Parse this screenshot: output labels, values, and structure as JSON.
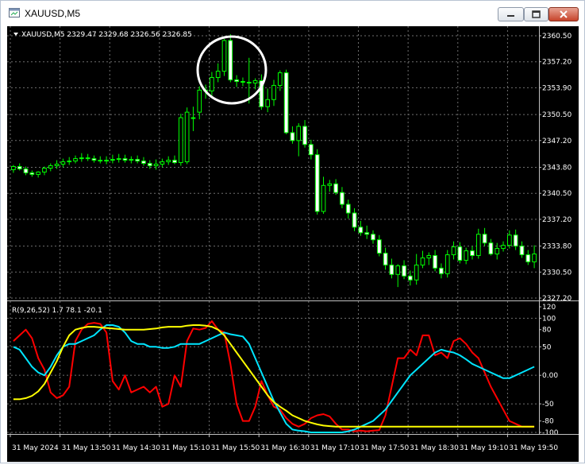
{
  "window": {
    "title": "XAUUSD,M5"
  },
  "main_chart": {
    "header": "XAUUSD,M5  2329.47 2329.68 2326.56 2326.85",
    "price_ticks": [
      "2360.50",
      "2357.20",
      "2353.90",
      "2350.50",
      "2347.20",
      "2343.80",
      "2340.50",
      "2337.20",
      "2333.80",
      "2330.50",
      "2327.20"
    ]
  },
  "indicator": {
    "header": "R(9,26,52) 1.7 78.1 -20.1",
    "ticks": [
      "120",
      "100",
      "80",
      "50",
      "0.00",
      "-50",
      "-80",
      "-100"
    ]
  },
  "time_axis": [
    "31 May 2024",
    "31 May 13:50",
    "31 May 14:30",
    "31 May 15:10",
    "31 May 15:50",
    "31 May 16:30",
    "31 May 17:10",
    "31 May 17:50",
    "31 May 18:30",
    "31 May 19:10",
    "31 May 19:50"
  ],
  "colors": {
    "background": "#000000",
    "grid": "#6f6f6f",
    "bull": "#00ff00",
    "bear": "#ffffff",
    "fast": "#ff0000",
    "mid": "#00e5ff",
    "slow": "#ffff00"
  },
  "chart_data": [
    {
      "type": "candlestick",
      "title": "XAUUSD,M5",
      "x": [
        "12:55",
        "13:00",
        "13:05",
        "13:10",
        "13:15",
        "13:20",
        "13:25",
        "13:30",
        "13:35",
        "13:40",
        "13:45",
        "13:50",
        "13:55",
        "14:00",
        "14:05",
        "14:10",
        "14:15",
        "14:20",
        "14:25",
        "14:30",
        "14:35",
        "14:40",
        "14:45",
        "14:50",
        "14:55",
        "15:00",
        "15:05",
        "15:10",
        "15:15",
        "15:20",
        "15:25",
        "15:30",
        "15:35",
        "15:40",
        "15:45",
        "15:50",
        "15:55",
        "16:00",
        "16:05",
        "16:10",
        "16:15",
        "16:20",
        "16:25",
        "16:30",
        "16:35",
        "16:40",
        "16:45",
        "16:50",
        "16:55",
        "17:00",
        "17:05",
        "17:10",
        "17:15",
        "17:20",
        "17:25",
        "17:30",
        "17:35",
        "17:40",
        "17:45",
        "17:50",
        "17:55",
        "18:00",
        "18:05",
        "18:10",
        "18:15",
        "18:20",
        "18:25",
        "18:30",
        "18:35",
        "18:40",
        "18:45",
        "18:50",
        "18:55",
        "19:00",
        "19:05",
        "19:10",
        "19:15",
        "19:20",
        "19:25",
        "19:30",
        "19:35",
        "19:40",
        "19:45",
        "19:50",
        "19:55"
      ],
      "open": [
        2343.5,
        2343.9,
        2343.6,
        2343.1,
        2342.9,
        2343.2,
        2343.7,
        2344.0,
        2344.2,
        2344.5,
        2344.6,
        2344.9,
        2345.0,
        2344.9,
        2344.7,
        2344.6,
        2344.7,
        2344.8,
        2344.9,
        2344.7,
        2344.8,
        2344.6,
        2344.3,
        2344.0,
        2344.2,
        2344.5,
        2344.7,
        2344.4,
        2344.5,
        2350.1,
        2350.8,
        2353.6,
        2353.5,
        2355.2,
        2356.0,
        2359.9,
        2354.9,
        2354.7,
        2354.6,
        2354.5,
        2354.8,
        2351.5,
        2352.4,
        2354.2,
        2355.8,
        2348.2,
        2347.2,
        2349.0,
        2346.7,
        2345.4,
        2338.2,
        2341.5,
        2341.7,
        2340.6,
        2339.1,
        2338.0,
        2336.2,
        2335.5,
        2335.3,
        2334.6,
        2332.9,
        2331.4,
        2330.2,
        2331.3,
        2330.0,
        2329.5,
        2331.4,
        2332.3,
        2332.6,
        2331.0,
        2330.3,
        2332.7,
        2333.7,
        2332.0,
        2333.2,
        2332.6,
        2335.3,
        2334.2,
        2332.8,
        2333.5,
        2333.9,
        2335.2,
        2333.8,
        2332.7,
        2331.8
      ],
      "high": [
        2344.1,
        2344.3,
        2343.9,
        2343.4,
        2343.3,
        2343.9,
        2344.3,
        2344.7,
        2344.9,
        2345.1,
        2345.3,
        2345.6,
        2345.5,
        2345.3,
        2345.2,
        2345.2,
        2345.4,
        2345.5,
        2345.4,
        2345.2,
        2345.3,
        2345.1,
        2344.7,
        2344.8,
        2344.9,
        2345.2,
        2345.3,
        2350.6,
        2351.4,
        2351.5,
        2354.1,
        2354.3,
        2355.9,
        2357.0,
        2360.1,
        2360.7,
        2355.5,
        2355.2,
        2357.7,
        2355.1,
        2355.6,
        2353.8,
        2354.9,
        2356.1,
        2356.2,
        2349.0,
        2349.4,
        2349.8,
        2347.3,
        2346.1,
        2342.6,
        2342.2,
        2342.3,
        2341.3,
        2339.7,
        2338.6,
        2337.0,
        2336.4,
        2335.8,
        2335.2,
        2333.6,
        2332.2,
        2331.5,
        2332.0,
        2330.7,
        2332.8,
        2333.2,
        2333.0,
        2333.3,
        2331.6,
        2333.3,
        2334.4,
        2334.3,
        2333.6,
        2333.8,
        2336.0,
        2336.1,
        2334.7,
        2334.2,
        2334.4,
        2335.8,
        2335.9,
        2334.4,
        2333.3,
        2333.9
      ],
      "low": [
        2343.1,
        2343.4,
        2342.8,
        2342.6,
        2342.5,
        2342.8,
        2343.3,
        2343.6,
        2343.8,
        2344.1,
        2344.3,
        2344.5,
        2344.6,
        2344.4,
        2344.3,
        2344.2,
        2344.3,
        2344.4,
        2344.4,
        2344.3,
        2344.3,
        2344.0,
        2343.6,
        2343.5,
        2343.8,
        2344.1,
        2344.2,
        2344.0,
        2344.2,
        2348.4,
        2349.9,
        2352.5,
        2352.8,
        2354.6,
        2355.4,
        2354.6,
        2354.0,
        2354.1,
        2351.9,
        2353.7,
        2351.1,
        2350.8,
        2351.6,
        2353.5,
        2348.0,
        2346.8,
        2345.2,
        2346.3,
        2344.8,
        2337.8,
        2337.9,
        2340.7,
        2340.3,
        2338.6,
        2337.3,
        2335.7,
        2335.1,
        2334.7,
        2334.1,
        2332.5,
        2330.8,
        2329.7,
        2328.6,
        2329.6,
        2328.8,
        2328.9,
        2331.0,
        2331.4,
        2330.6,
        2329.7,
        2329.8,
        2332.1,
        2331.6,
        2331.5,
        2332.1,
        2332.2,
        2333.8,
        2332.6,
        2332.1,
        2333.1,
        2333.5,
        2333.3,
        2332.3,
        2331.4,
        2331.0
      ],
      "close": [
        2343.9,
        2343.6,
        2343.1,
        2342.9,
        2343.2,
        2343.7,
        2344.0,
        2344.2,
        2344.5,
        2344.6,
        2344.9,
        2345.0,
        2344.9,
        2344.7,
        2344.6,
        2344.7,
        2344.8,
        2344.9,
        2344.7,
        2344.8,
        2344.6,
        2344.3,
        2344.0,
        2344.2,
        2344.5,
        2344.7,
        2344.4,
        2350.1,
        2350.8,
        2350.1,
        2353.6,
        2353.5,
        2355.2,
        2356.0,
        2359.9,
        2354.9,
        2354.7,
        2354.6,
        2354.5,
        2354.8,
        2351.5,
        2352.4,
        2354.2,
        2355.8,
        2348.2,
        2347.2,
        2349.0,
        2346.7,
        2345.4,
        2338.2,
        2341.5,
        2341.7,
        2340.6,
        2339.1,
        2338.0,
        2336.2,
        2335.5,
        2335.3,
        2334.6,
        2332.9,
        2331.4,
        2330.2,
        2331.3,
        2330.0,
        2329.5,
        2331.4,
        2332.3,
        2332.6,
        2331.0,
        2330.3,
        2332.7,
        2333.7,
        2332.0,
        2333.2,
        2332.6,
        2335.3,
        2334.2,
        2332.8,
        2333.5,
        2333.9,
        2335.2,
        2333.8,
        2332.7,
        2331.8,
        2332.8
      ],
      "ylim": [
        2327.2,
        2360.5
      ]
    },
    {
      "type": "line",
      "title": "R(9,26,52)",
      "x_count": 85,
      "ylim": [
        -100,
        100
      ],
      "series": [
        {
          "color": "#ff0000",
          "values": [
            60,
            70,
            80,
            65,
            30,
            10,
            -30,
            -40,
            -35,
            -20,
            60,
            80,
            90,
            92,
            90,
            75,
            -10,
            -25,
            0,
            -30,
            -25,
            -20,
            -30,
            -20,
            -55,
            -50,
            0,
            -20,
            60,
            82,
            80,
            83,
            95,
            80,
            75,
            20,
            -50,
            -80,
            -80,
            -55,
            -10,
            -35,
            -55,
            -60,
            -75,
            -85,
            -90,
            -85,
            -75,
            -70,
            -68,
            -72,
            -85,
            -95,
            -95,
            -98,
            -97,
            -98,
            -97,
            -96,
            -70,
            -20,
            30,
            30,
            45,
            35,
            70,
            70,
            35,
            40,
            30,
            60,
            65,
            55,
            40,
            30,
            5,
            -20,
            -40,
            -60,
            -80,
            -85,
            -90,
            -90,
            -90
          ]
        },
        {
          "color": "#00e5ff",
          "values": [
            50,
            45,
            30,
            15,
            5,
            0,
            15,
            35,
            50,
            55,
            55,
            60,
            65,
            70,
            80,
            88,
            88,
            85,
            75,
            60,
            55,
            55,
            50,
            50,
            48,
            48,
            50,
            55,
            55,
            55,
            55,
            60,
            65,
            70,
            75,
            72,
            70,
            68,
            55,
            30,
            5,
            -20,
            -45,
            -65,
            -85,
            -95,
            -97,
            -98,
            -100,
            -100,
            -100,
            -100,
            -100,
            -100,
            -98,
            -95,
            -90,
            -85,
            -80,
            -70,
            -60,
            -45,
            -30,
            -15,
            0,
            10,
            20,
            30,
            40,
            45,
            42,
            40,
            35,
            28,
            20,
            15,
            10,
            5,
            0,
            -5,
            -5,
            0,
            5,
            10,
            15
          ]
        },
        {
          "color": "#ffff00",
          "values": [
            -42,
            -42,
            -40,
            -36,
            -28,
            -15,
            5,
            25,
            50,
            70,
            80,
            83,
            85,
            85,
            84,
            83,
            82,
            81,
            80,
            80,
            80,
            80,
            81,
            82,
            84,
            85,
            85,
            85,
            87,
            88,
            88,
            87,
            85,
            80,
            70,
            55,
            40,
            25,
            10,
            -5,
            -20,
            -35,
            -47,
            -55,
            -62,
            -70,
            -75,
            -80,
            -83,
            -86,
            -88,
            -89,
            -90,
            -90,
            -90,
            -90,
            -90,
            -90,
            -90,
            -90,
            -90,
            -90,
            -90,
            -90,
            -90,
            -90,
            -90,
            -90,
            -90,
            -90,
            -90,
            -90,
            -90,
            -90,
            -90,
            -90,
            -90,
            -90,
            -90,
            -90,
            -90,
            -90,
            -90,
            -90,
            -90
          ]
        }
      ]
    }
  ]
}
